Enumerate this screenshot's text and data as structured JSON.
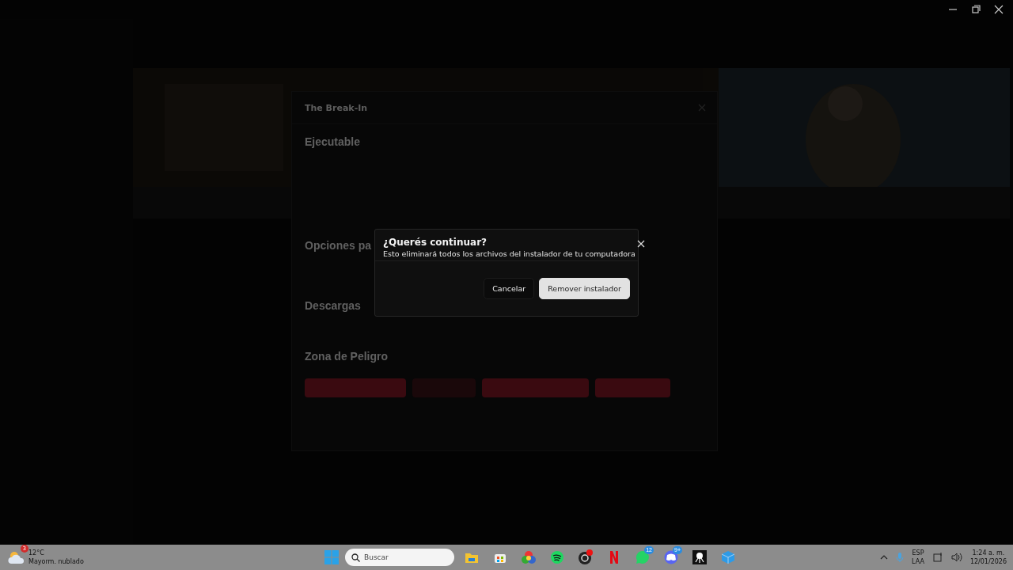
{
  "settings_modal": {
    "title": "The Break-In",
    "sections": [
      {
        "heading": "Ejecutable"
      },
      {
        "heading": "Opciones pa"
      },
      {
        "heading": "Descargas"
      },
      {
        "heading": "Zona de Peligro"
      }
    ],
    "danger_buttons": [
      {
        "disabled": false
      },
      {
        "disabled": true
      },
      {
        "disabled": false
      },
      {
        "disabled": false
      }
    ]
  },
  "dialog": {
    "title": "¿Querés continuar?",
    "message": "Esto eliminará todos los archivos del instalador de tu computadora",
    "buttons": [
      {
        "label": "Cancelar",
        "kind": "secondary"
      },
      {
        "label": "Remover instalador",
        "kind": "primary"
      }
    ]
  },
  "taskbar": {
    "weather": {
      "temperature": "12°C",
      "condition": "Mayorm. nublado",
      "badge": "3"
    },
    "search": {
      "placeholder": "Buscar"
    },
    "apps": [
      {
        "kind": "folder"
      },
      {
        "kind": "store"
      },
      {
        "kind": "browser"
      },
      {
        "kind": "music"
      },
      {
        "kind": "recorder"
      },
      {
        "kind": "netflix"
      },
      {
        "kind": "chat",
        "badge": "12"
      },
      {
        "kind": "discord",
        "badge": "9+"
      },
      {
        "kind": "cat"
      },
      {
        "kind": "cube"
      }
    ],
    "tray": {
      "language": "ESP",
      "layout": "LAA",
      "time": "1:24 a. m.",
      "date": "12/01/2026"
    }
  }
}
